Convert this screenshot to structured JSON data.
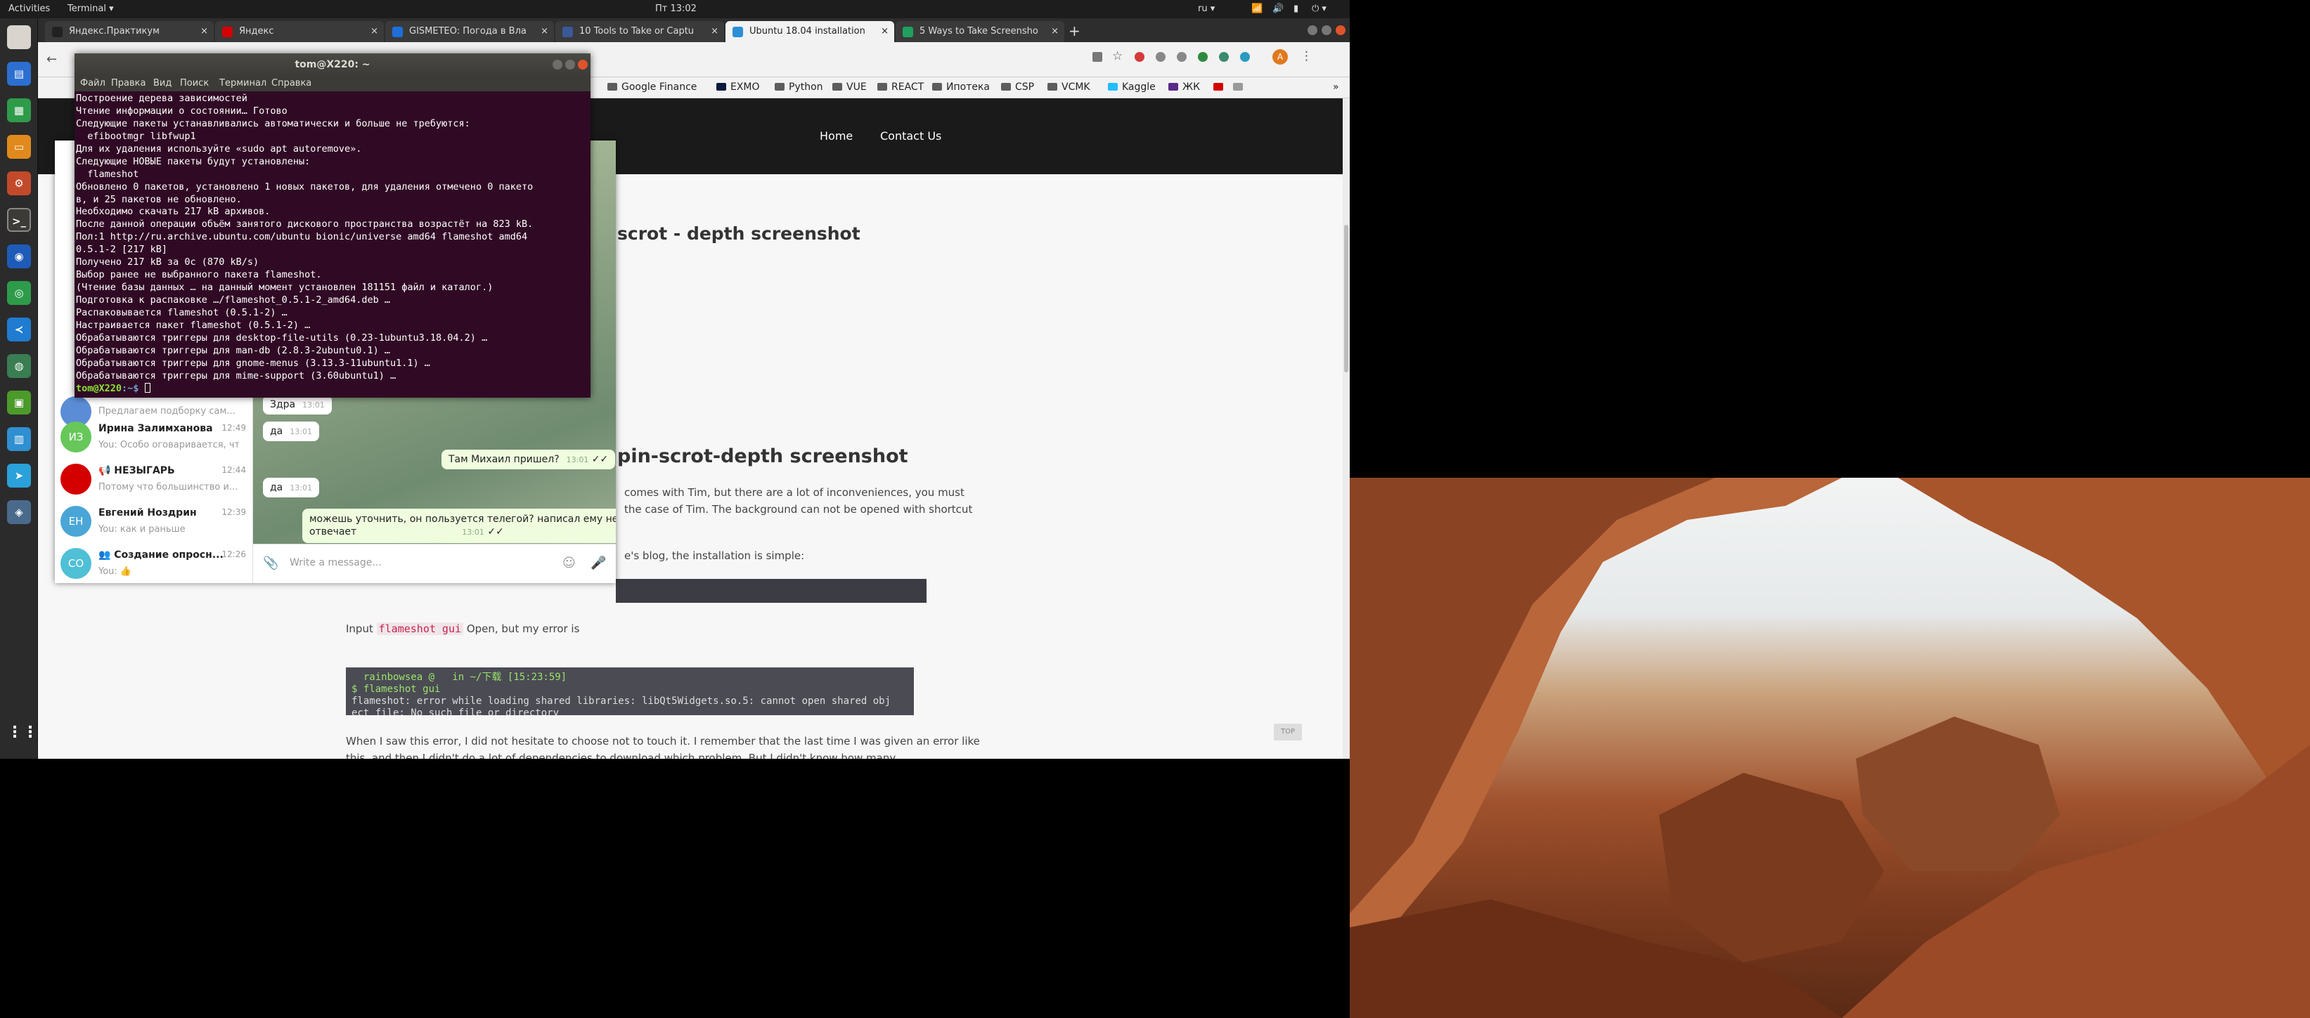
{
  "topbar": {
    "activities": "Activities",
    "app": "Terminal",
    "clock": "Пт 13:02",
    "lang": "ru"
  },
  "browser": {
    "tabs": [
      {
        "label": "Яндекс.Практикум",
        "color": "#222222"
      },
      {
        "label": "Яндекс",
        "color": "#d40000"
      },
      {
        "label": "GISMETEO: Погода в Вла",
        "color": "#1e6fd9"
      },
      {
        "label": "10 Tools to Take or Captu",
        "color": "#3b5998"
      },
      {
        "label": "Ubuntu 18.04 installation",
        "color": "#2b8fd6"
      },
      {
        "label": "5 Ways to Take Screensho",
        "color": "#20a060"
      }
    ],
    "bookmarks": [
      "Google Finance",
      "EXMO",
      "Python",
      "VUE",
      "REACT",
      "Ипотека",
      "CSP",
      "VCMK",
      "Kaggle",
      "ЖК"
    ]
  },
  "site": {
    "nav": [
      "Home",
      "Contact Us"
    ],
    "heading1": "scrot - depth screenshot",
    "heading2": "pin-scrot-depth screenshot",
    "para1": "comes with Tim, but there are a lot of inconveniences, you must",
    "para2": "the case of Tim. The background can not be opened with shortcut",
    "para3": "e's blog, the installation is simple:",
    "input_prefix": "Input",
    "input_code": "flameshot gui",
    "input_suffix": "Open, but my error is",
    "code_lines": [
      "  rainbowsea @   in ~/下载 [15:23:59]",
      "$ flameshot gui",
      "flameshot: error while loading shared libraries: libQt5Widgets.so.5: cannot open shared obj",
      "ect file: No such file or directory"
    ],
    "para4": "When I saw this error, I did not hesitate to choose not to touch it. I remember that the last time I was given an error like",
    "para5": "this, and then I didn't do a lot of dependencies to download which problem. But I didn't know how many",
    "top_btn": "TOP"
  },
  "telegram": {
    "chats": [
      {
        "initials": "",
        "name": "",
        "msg": "Предлагаем подборку сам...",
        "time": "",
        "color": "#5b8dd6"
      },
      {
        "initials": "ИЗ",
        "name": "Ирина Залимханова",
        "msg": "You: Особо оговаривается, что...",
        "time": "12:49",
        "color": "#67c75b"
      },
      {
        "initials": "",
        "name": "📢 НЕЗЫГАРЬ",
        "msg": "Потому что большинство и...",
        "time": "12:44",
        "color": "#d40000"
      },
      {
        "initials": "ЕН",
        "name": "Евгений Ноздрин",
        "msg": "You: как и раньше",
        "time": "12:39",
        "color": "#4aa6d6"
      },
      {
        "initials": "СО",
        "name": "👥 Создание опросн...",
        "msg": "You: 👍",
        "time": "12:26",
        "color": "#4fc0d6"
      }
    ],
    "messages": [
      {
        "text": "Здра",
        "time": "13:01",
        "dir": "in"
      },
      {
        "text": "да",
        "time": "13:01",
        "dir": "in"
      },
      {
        "text": "Там Михаил пришел?",
        "time": "13:01",
        "dir": "out"
      },
      {
        "text": "да",
        "time": "13:01",
        "dir": "in"
      },
      {
        "text": "можешь уточнить, он пользуется телегой? написал ему не",
        "time": "",
        "dir": "out"
      },
      {
        "text": "отвечает",
        "time": "13:01",
        "dir": "out"
      }
    ],
    "input_placeholder": "Write a message..."
  },
  "terminal": {
    "title": "tom@X220: ~",
    "menu": [
      "Файл",
      "Правка",
      "Вид",
      "Поиск",
      "Терминал",
      "Справка"
    ],
    "lines": [
      "Построение дерева зависимостей",
      "Чтение информации о состоянии… Готово",
      "Следующие пакеты устанавливались автоматически и больше не требуются:",
      "  efibootmgr libfwup1",
      "Для их удаления используйте «sudo apt autoremove».",
      "Следующие НОВЫЕ пакеты будут установлены:",
      "  flameshot",
      "Обновлено 0 пакетов, установлено 1 новых пакетов, для удаления отмечено 0 пакето",
      "в, и 25 пакетов не обновлено.",
      "Необходимо скачать 217 kB архивов.",
      "После данной операции объём занятого дискового пространства возрастёт на 823 kB.",
      "Пол:1 http://ru.archive.ubuntu.com/ubuntu bionic/universe amd64 flameshot amd64",
      "0.5.1-2 [217 kB]",
      "Получено 217 kB за 0с (870 kB/s)",
      "Выбор ранее не выбранного пакета flameshot.",
      "(Чтение базы данных … на данный момент установлен 181151 файл и каталог.)",
      "Подготовка к распаковке …/flameshot_0.5.1-2_amd64.deb …",
      "Распаковывается flameshot (0.5.1-2) …",
      "Настраивается пакет flameshot (0.5.1-2) …",
      "Обрабатываются триггеры для desktop-file-utils (0.23-1ubuntu3.18.04.2) …",
      "Обрабатываются триггеры для man-db (2.8.3-2ubuntu0.1) …",
      "Обрабатываются триггеры для gnome-menus (3.13.3-11ubuntu1.1) …",
      "Обрабатываются триггеры для mime-support (3.60ubuntu1) …"
    ],
    "prompt_user": "tom@X220",
    "prompt_path": ":~$ "
  }
}
